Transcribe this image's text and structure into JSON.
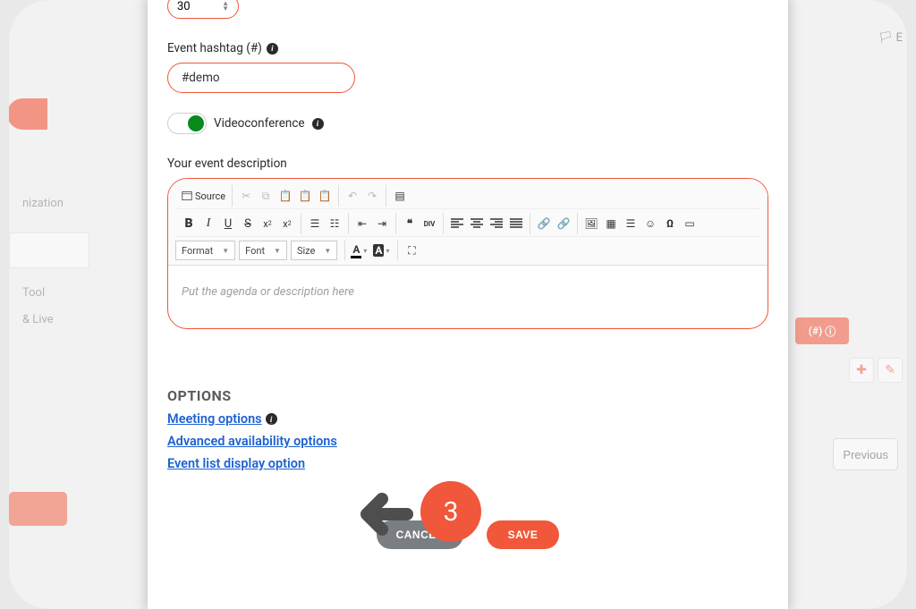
{
  "background": {
    "sidebar_items": [
      "nization",
      "Tool",
      "& Live"
    ],
    "tag_text": "(#)",
    "prev_btn": "Previous",
    "lang": "E"
  },
  "form": {
    "number_value": "30",
    "hashtag_label": "Event hashtag (#)",
    "hashtag_value": "#demo",
    "videoconf_label": "Videoconference",
    "description_label": "Your event description",
    "editor_placeholder": "Put the agenda or description here"
  },
  "toolbar": {
    "source": "Source",
    "format": "Format",
    "font": "Font",
    "size": "Size"
  },
  "options": {
    "heading": "OPTIONS",
    "meeting": "Meeting options",
    "availability": "Advanced availability options",
    "display": "Event list display option"
  },
  "buttons": {
    "cancel": "CANCEL",
    "save": "SAVE"
  },
  "annotation": {
    "step": "3"
  }
}
